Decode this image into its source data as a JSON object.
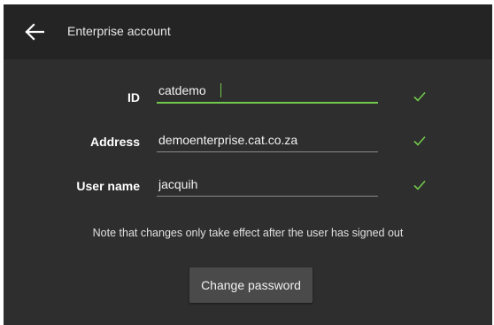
{
  "header": {
    "back_icon": "arrow-left-icon",
    "title": "Enterprise account"
  },
  "form": {
    "id": {
      "label": "ID",
      "value": "catdemo",
      "valid": true
    },
    "address": {
      "label": "Address",
      "value": "demoenterprise.cat.co.za",
      "valid": true
    },
    "username": {
      "label": "User name",
      "value": "jacquih",
      "valid": true
    }
  },
  "note": "Note that changes only take effect after the user has signed out",
  "change_password_label": "Change password",
  "colors": {
    "accent": "#73c94b",
    "background": "#2e2e2e",
    "header": "#242424",
    "button": "#4a4a4a"
  }
}
